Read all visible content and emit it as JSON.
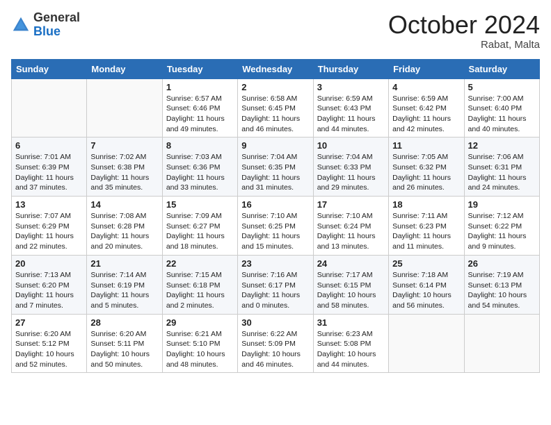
{
  "header": {
    "logo_general": "General",
    "logo_blue": "Blue",
    "month_title": "October 2024",
    "location": "Rabat, Malta"
  },
  "weekdays": [
    "Sunday",
    "Monday",
    "Tuesday",
    "Wednesday",
    "Thursday",
    "Friday",
    "Saturday"
  ],
  "weeks": [
    [
      {
        "day": "",
        "sunrise": "",
        "sunset": "",
        "daylight": ""
      },
      {
        "day": "",
        "sunrise": "",
        "sunset": "",
        "daylight": ""
      },
      {
        "day": "1",
        "sunrise": "Sunrise: 6:57 AM",
        "sunset": "Sunset: 6:46 PM",
        "daylight": "Daylight: 11 hours and 49 minutes."
      },
      {
        "day": "2",
        "sunrise": "Sunrise: 6:58 AM",
        "sunset": "Sunset: 6:45 PM",
        "daylight": "Daylight: 11 hours and 46 minutes."
      },
      {
        "day": "3",
        "sunrise": "Sunrise: 6:59 AM",
        "sunset": "Sunset: 6:43 PM",
        "daylight": "Daylight: 11 hours and 44 minutes."
      },
      {
        "day": "4",
        "sunrise": "Sunrise: 6:59 AM",
        "sunset": "Sunset: 6:42 PM",
        "daylight": "Daylight: 11 hours and 42 minutes."
      },
      {
        "day": "5",
        "sunrise": "Sunrise: 7:00 AM",
        "sunset": "Sunset: 6:40 PM",
        "daylight": "Daylight: 11 hours and 40 minutes."
      }
    ],
    [
      {
        "day": "6",
        "sunrise": "Sunrise: 7:01 AM",
        "sunset": "Sunset: 6:39 PM",
        "daylight": "Daylight: 11 hours and 37 minutes."
      },
      {
        "day": "7",
        "sunrise": "Sunrise: 7:02 AM",
        "sunset": "Sunset: 6:38 PM",
        "daylight": "Daylight: 11 hours and 35 minutes."
      },
      {
        "day": "8",
        "sunrise": "Sunrise: 7:03 AM",
        "sunset": "Sunset: 6:36 PM",
        "daylight": "Daylight: 11 hours and 33 minutes."
      },
      {
        "day": "9",
        "sunrise": "Sunrise: 7:04 AM",
        "sunset": "Sunset: 6:35 PM",
        "daylight": "Daylight: 11 hours and 31 minutes."
      },
      {
        "day": "10",
        "sunrise": "Sunrise: 7:04 AM",
        "sunset": "Sunset: 6:33 PM",
        "daylight": "Daylight: 11 hours and 29 minutes."
      },
      {
        "day": "11",
        "sunrise": "Sunrise: 7:05 AM",
        "sunset": "Sunset: 6:32 PM",
        "daylight": "Daylight: 11 hours and 26 minutes."
      },
      {
        "day": "12",
        "sunrise": "Sunrise: 7:06 AM",
        "sunset": "Sunset: 6:31 PM",
        "daylight": "Daylight: 11 hours and 24 minutes."
      }
    ],
    [
      {
        "day": "13",
        "sunrise": "Sunrise: 7:07 AM",
        "sunset": "Sunset: 6:29 PM",
        "daylight": "Daylight: 11 hours and 22 minutes."
      },
      {
        "day": "14",
        "sunrise": "Sunrise: 7:08 AM",
        "sunset": "Sunset: 6:28 PM",
        "daylight": "Daylight: 11 hours and 20 minutes."
      },
      {
        "day": "15",
        "sunrise": "Sunrise: 7:09 AM",
        "sunset": "Sunset: 6:27 PM",
        "daylight": "Daylight: 11 hours and 18 minutes."
      },
      {
        "day": "16",
        "sunrise": "Sunrise: 7:10 AM",
        "sunset": "Sunset: 6:25 PM",
        "daylight": "Daylight: 11 hours and 15 minutes."
      },
      {
        "day": "17",
        "sunrise": "Sunrise: 7:10 AM",
        "sunset": "Sunset: 6:24 PM",
        "daylight": "Daylight: 11 hours and 13 minutes."
      },
      {
        "day": "18",
        "sunrise": "Sunrise: 7:11 AM",
        "sunset": "Sunset: 6:23 PM",
        "daylight": "Daylight: 11 hours and 11 minutes."
      },
      {
        "day": "19",
        "sunrise": "Sunrise: 7:12 AM",
        "sunset": "Sunset: 6:22 PM",
        "daylight": "Daylight: 11 hours and 9 minutes."
      }
    ],
    [
      {
        "day": "20",
        "sunrise": "Sunrise: 7:13 AM",
        "sunset": "Sunset: 6:20 PM",
        "daylight": "Daylight: 11 hours and 7 minutes."
      },
      {
        "day": "21",
        "sunrise": "Sunrise: 7:14 AM",
        "sunset": "Sunset: 6:19 PM",
        "daylight": "Daylight: 11 hours and 5 minutes."
      },
      {
        "day": "22",
        "sunrise": "Sunrise: 7:15 AM",
        "sunset": "Sunset: 6:18 PM",
        "daylight": "Daylight: 11 hours and 2 minutes."
      },
      {
        "day": "23",
        "sunrise": "Sunrise: 7:16 AM",
        "sunset": "Sunset: 6:17 PM",
        "daylight": "Daylight: 11 hours and 0 minutes."
      },
      {
        "day": "24",
        "sunrise": "Sunrise: 7:17 AM",
        "sunset": "Sunset: 6:15 PM",
        "daylight": "Daylight: 10 hours and 58 minutes."
      },
      {
        "day": "25",
        "sunrise": "Sunrise: 7:18 AM",
        "sunset": "Sunset: 6:14 PM",
        "daylight": "Daylight: 10 hours and 56 minutes."
      },
      {
        "day": "26",
        "sunrise": "Sunrise: 7:19 AM",
        "sunset": "Sunset: 6:13 PM",
        "daylight": "Daylight: 10 hours and 54 minutes."
      }
    ],
    [
      {
        "day": "27",
        "sunrise": "Sunrise: 6:20 AM",
        "sunset": "Sunset: 5:12 PM",
        "daylight": "Daylight: 10 hours and 52 minutes."
      },
      {
        "day": "28",
        "sunrise": "Sunrise: 6:20 AM",
        "sunset": "Sunset: 5:11 PM",
        "daylight": "Daylight: 10 hours and 50 minutes."
      },
      {
        "day": "29",
        "sunrise": "Sunrise: 6:21 AM",
        "sunset": "Sunset: 5:10 PM",
        "daylight": "Daylight: 10 hours and 48 minutes."
      },
      {
        "day": "30",
        "sunrise": "Sunrise: 6:22 AM",
        "sunset": "Sunset: 5:09 PM",
        "daylight": "Daylight: 10 hours and 46 minutes."
      },
      {
        "day": "31",
        "sunrise": "Sunrise: 6:23 AM",
        "sunset": "Sunset: 5:08 PM",
        "daylight": "Daylight: 10 hours and 44 minutes."
      },
      {
        "day": "",
        "sunrise": "",
        "sunset": "",
        "daylight": ""
      },
      {
        "day": "",
        "sunrise": "",
        "sunset": "",
        "daylight": ""
      }
    ]
  ]
}
